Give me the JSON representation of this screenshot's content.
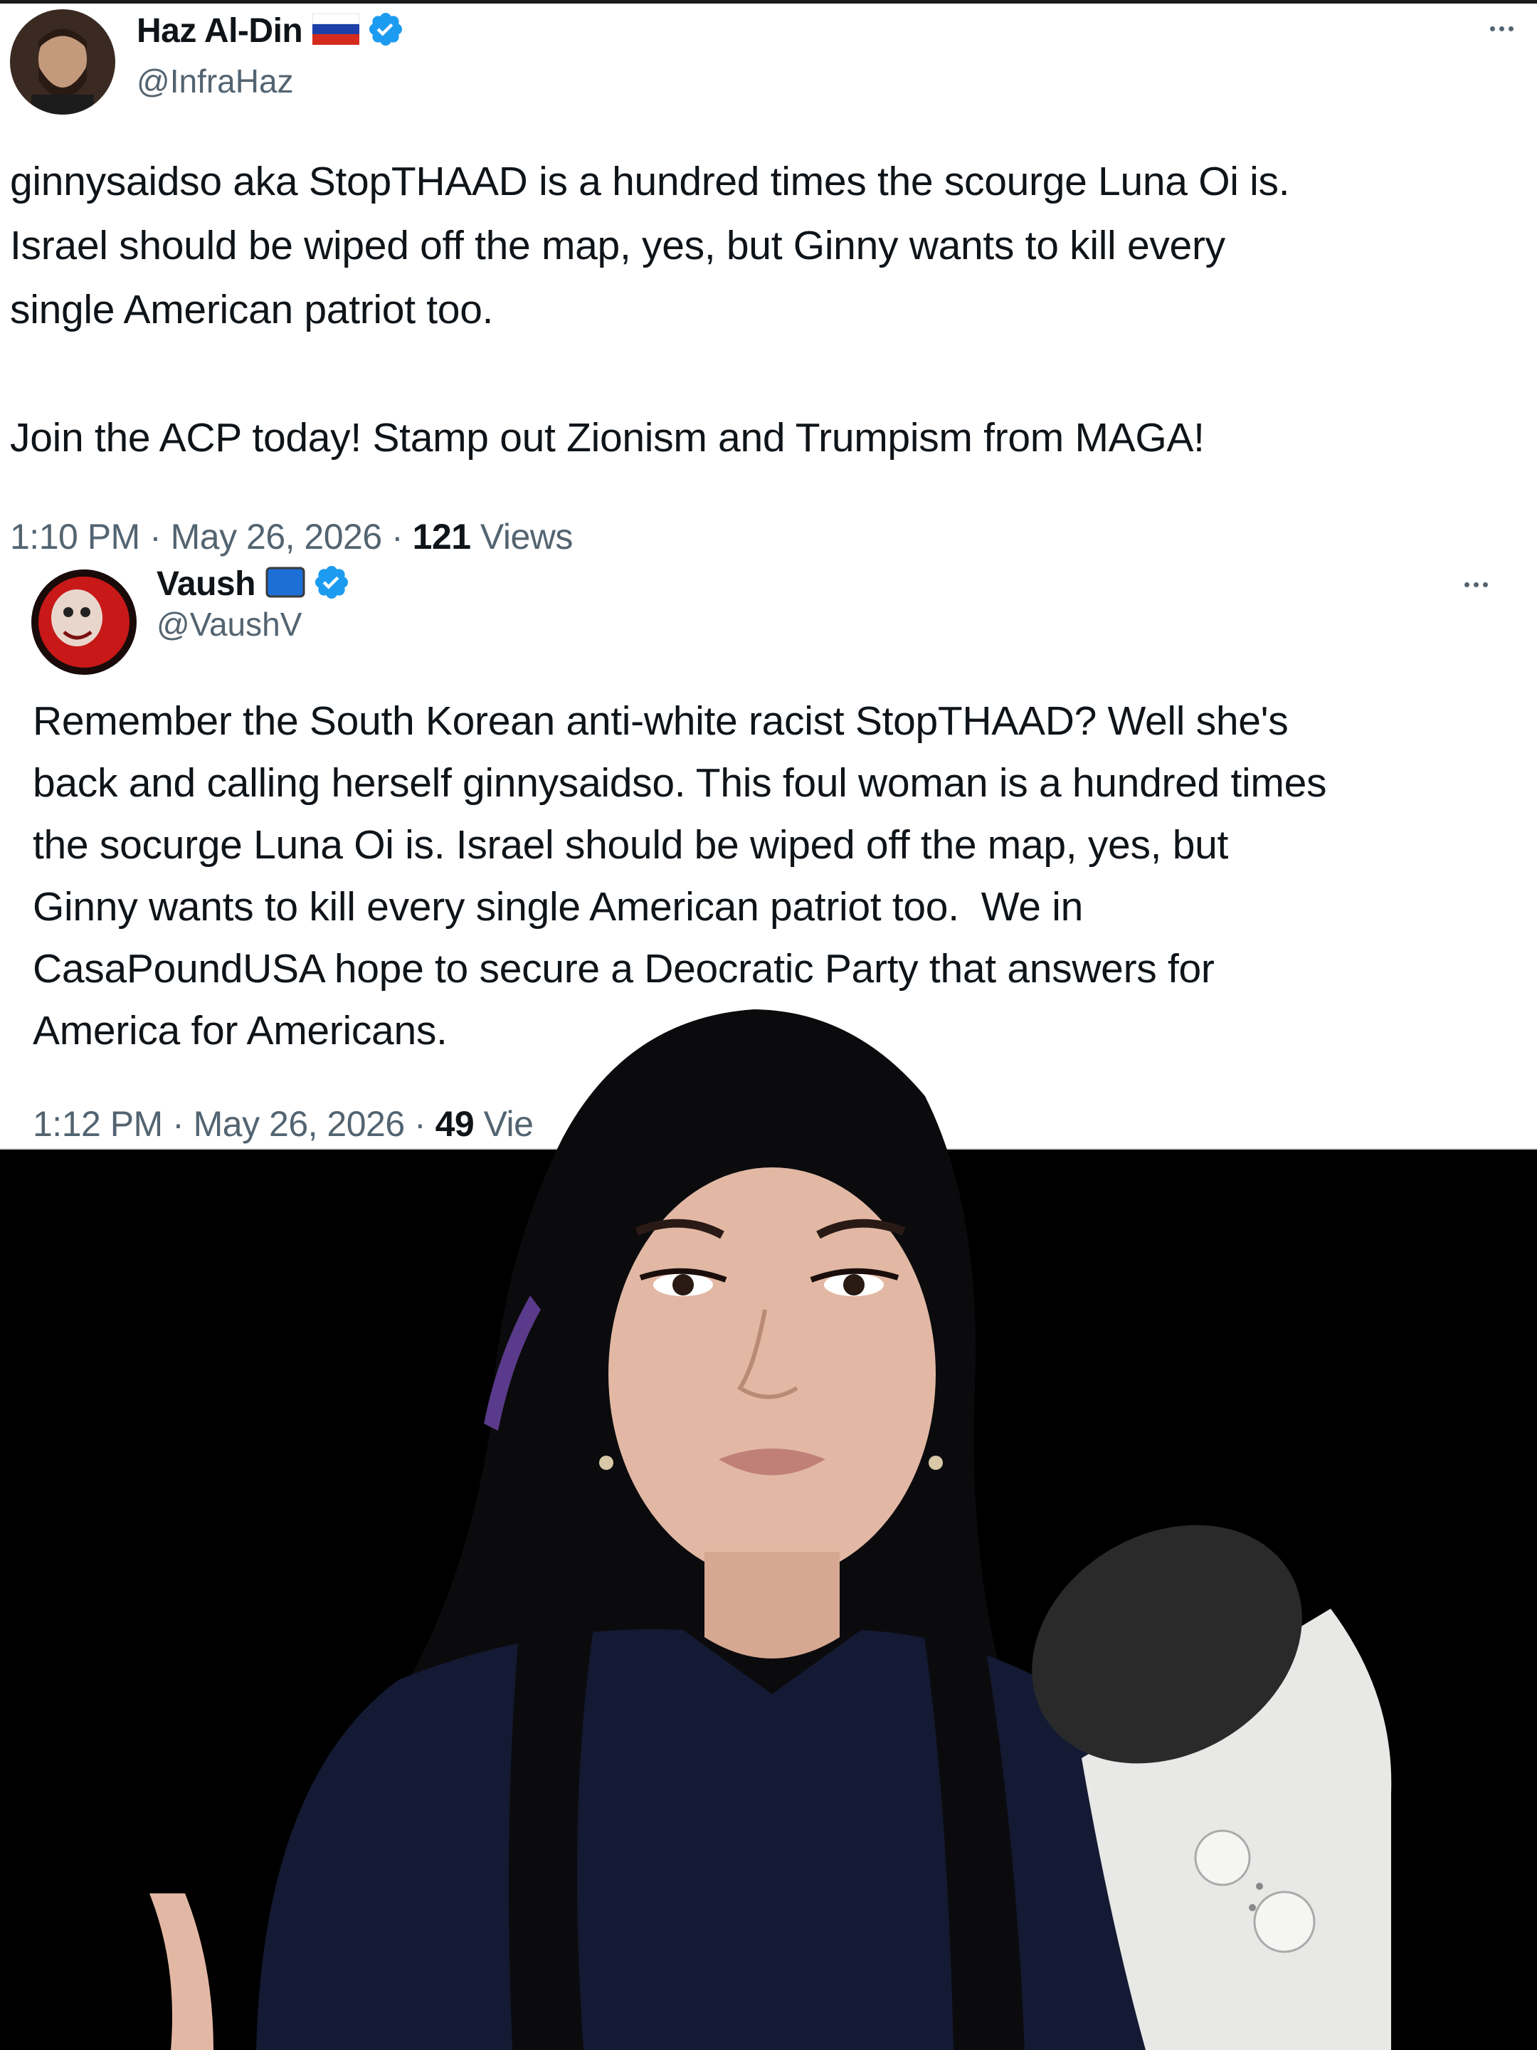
{
  "tweet1": {
    "name": "Haz Al-Din",
    "handle": "@InfraHaz",
    "text": "ginnysaidso aka StopTHAAD is a hundred times the scourge Luna Oi is.\nIsrael should be wiped off the map, yes, but Ginny wants to kill every\nsingle American patriot too.\n\nJoin the ACP today! Stamp out Zionism and Trumpism from MAGA!",
    "time": "1:10 PM",
    "date": "May 26, 2026",
    "views_count": "121",
    "views_label": "Views",
    "sep": " · "
  },
  "tweet2": {
    "name": "Vaush",
    "handle": "@VaushV",
    "text": "Remember the South Korean anti-white racist StopTHAAD? Well she's\nback and calling herself ginnysaidso. This foul woman is a hundred times\nthe socurge Luna Oi is. Israel should be wiped off the map, yes, but\nGinny wants to kill every single American patriot too.  We in\nCasaPoundUSA hope to secure a Deocratic Party that answers for\nAmerica for Americans.",
    "time": "1:12 PM",
    "date": "May 26, 2026",
    "views_count": "49",
    "views_label": "Vie",
    "sep": " · "
  },
  "colors": {
    "verified": "#1d9bf0",
    "text": "#0f1419",
    "muted": "#536471"
  },
  "icons": {
    "flag1": "russia-flag-icon",
    "flag2": "blue-square-icon",
    "verified": "verified-badge-icon",
    "more": "more-options-icon"
  }
}
